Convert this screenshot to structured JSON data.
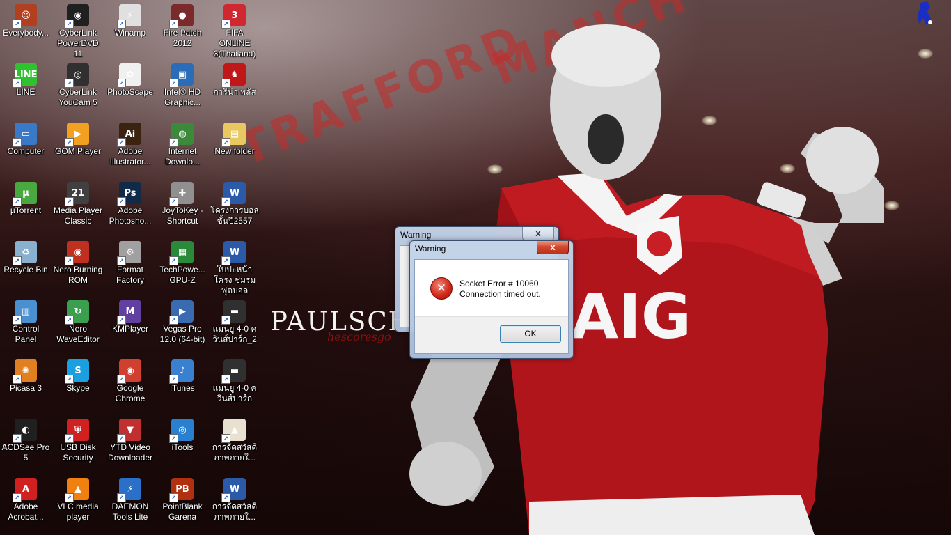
{
  "wallpaper": {
    "stand_text_1": "TRAFFORD",
    "stand_text_2": "MANCH",
    "sponsor": "AIG",
    "signature": "PAULSCH",
    "signature_sub": "hescoresgo"
  },
  "desktop_icons": [
    {
      "label": "Everybody...",
      "icon": "avatar-icon",
      "color": "#b04020",
      "text": "☺"
    },
    {
      "label": "CyberLink PowerDVD 11",
      "icon": "powerdvd-icon",
      "color": "#202020",
      "text": "◉"
    },
    {
      "label": "Winamp",
      "icon": "winamp-icon",
      "color": "#e0e0e0",
      "text": "⚡"
    },
    {
      "label": "Fire Patch 2012",
      "icon": "firepatch-icon",
      "color": "#7a2a2a",
      "text": "●"
    },
    {
      "label": "FIFA ONLINE 3(Thailand)",
      "icon": "fifa-icon",
      "color": "#d02830",
      "text": "3"
    },
    {
      "label": "LINE",
      "icon": "line-icon",
      "color": "#2fc12f",
      "text": "LINE"
    },
    {
      "label": "CyberLink YouCam 5",
      "icon": "youcam-icon",
      "color": "#303030",
      "text": "◎"
    },
    {
      "label": "PhotoScape",
      "icon": "photoscape-icon",
      "color": "#f0f0f0",
      "text": "✿"
    },
    {
      "label": "Intel® HD Graphic...",
      "icon": "intel-icon",
      "color": "#2a6cb8",
      "text": "▣"
    },
    {
      "label": "การีน่า พลัส",
      "icon": "garena-icon",
      "color": "#c01818",
      "text": "♞"
    },
    {
      "label": "Computer",
      "icon": "computer-icon",
      "color": "#3a78c8",
      "text": "▭"
    },
    {
      "label": "GOM Player",
      "icon": "gom-icon",
      "color": "#f2a020",
      "text": "▶"
    },
    {
      "label": "Adobe Illustrator...",
      "icon": "illustrator-icon",
      "color": "#3a2410",
      "text": "Ai"
    },
    {
      "label": "Internet Downlo...",
      "icon": "idm-icon",
      "color": "#3a8a3a",
      "text": "◍"
    },
    {
      "label": "New folder",
      "icon": "folder-icon",
      "color": "#e8c860",
      "text": "▤"
    },
    {
      "label": "µTorrent",
      "icon": "utorrent-icon",
      "color": "#4aa840",
      "text": "µ"
    },
    {
      "label": "Media Player Classic",
      "icon": "mpc-icon",
      "color": "#404040",
      "text": "21"
    },
    {
      "label": "Adobe Photosho...",
      "icon": "photoshop-icon",
      "color": "#102a48",
      "text": "Ps"
    },
    {
      "label": "JoyToKey - Shortcut",
      "icon": "joytokey-icon",
      "color": "#909090",
      "text": "✚"
    },
    {
      "label": "โครงการบอล ชั้นปี2557",
      "icon": "word-doc-icon",
      "color": "#2a5aa8",
      "text": "W"
    },
    {
      "label": "Recycle Bin",
      "icon": "recycle-bin-icon",
      "color": "#8ab0d0",
      "text": "♻"
    },
    {
      "label": "Nero Burning ROM",
      "icon": "nero-icon",
      "color": "#c03020",
      "text": "◉"
    },
    {
      "label": "Format Factory",
      "icon": "formatfactory-icon",
      "color": "#a0a0a0",
      "text": "⚙"
    },
    {
      "label": "TechPowe... GPU-Z",
      "icon": "gpuz-icon",
      "color": "#2a8a3a",
      "text": "▦"
    },
    {
      "label": "ใบปะหน้าโครง ชมรมฟุตบอล",
      "icon": "word-doc-icon",
      "color": "#2a5aa8",
      "text": "W"
    },
    {
      "label": "Control Panel",
      "icon": "control-panel-icon",
      "color": "#4a90d0",
      "text": "▥"
    },
    {
      "label": "Nero WaveEditor",
      "icon": "nero-wave-icon",
      "color": "#3aa050",
      "text": "↻"
    },
    {
      "label": "KMPlayer",
      "icon": "kmplayer-icon",
      "color": "#6040a0",
      "text": "M"
    },
    {
      "label": "Vegas Pro 12.0 (64-bit)",
      "icon": "vegas-icon",
      "color": "#3a6ab0",
      "text": "▶"
    },
    {
      "label": "แมนยู 4-0 ควินส์ปาร์ก_2",
      "icon": "video-file-icon",
      "color": "#303030",
      "text": "▬"
    },
    {
      "label": "Picasa 3",
      "icon": "picasa-icon",
      "color": "#e08020",
      "text": "✺"
    },
    {
      "label": "Skype",
      "icon": "skype-icon",
      "color": "#1aa0e0",
      "text": "S"
    },
    {
      "label": "Google Chrome",
      "icon": "chrome-icon",
      "color": "#d04030",
      "text": "◉"
    },
    {
      "label": "iTunes",
      "icon": "itunes-icon",
      "color": "#3a80d0",
      "text": "♪"
    },
    {
      "label": "แมนยู 4-0 ควินส์ปาร์ก",
      "icon": "video-file-icon",
      "color": "#303030",
      "text": "▬"
    },
    {
      "label": "ACDSee Pro 5",
      "icon": "acdsee-icon",
      "color": "#202020",
      "text": "◐"
    },
    {
      "label": "USB Disk Security",
      "icon": "usb-security-icon",
      "color": "#d02020",
      "text": "⛨"
    },
    {
      "label": "YTD Video Downloader",
      "icon": "ytd-icon",
      "color": "#c03030",
      "text": "▼"
    },
    {
      "label": "iTools",
      "icon": "itools-icon",
      "color": "#2a80d0",
      "text": "◎"
    },
    {
      "label": "การจัดสวัสดิ ภาพภายใ...",
      "icon": "picture-file-icon",
      "color": "#e8e0d0",
      "text": "▲"
    },
    {
      "label": "Adobe Acrobat...",
      "icon": "acrobat-icon",
      "color": "#d02020",
      "text": "A"
    },
    {
      "label": "VLC media player",
      "icon": "vlc-icon",
      "color": "#f08010",
      "text": "▲"
    },
    {
      "label": "DAEMON Tools Lite",
      "icon": "daemon-icon",
      "color": "#2a70c8",
      "text": "⚡"
    },
    {
      "label": "PointBlank Garena",
      "icon": "pointblank-icon",
      "color": "#b03010",
      "text": "PB"
    },
    {
      "label": "การจัดสวัสดิ ภาพภายใ...",
      "icon": "word-doc-icon",
      "color": "#2a5aa8",
      "text": "W"
    }
  ],
  "back_dialog": {
    "title": "Warning",
    "close_label": "x"
  },
  "front_dialog": {
    "title": "Warning",
    "close_label": "x",
    "message_line1": "Socket Error # 10060",
    "message_line2": "Connection timed out.",
    "error_glyph": "✕",
    "ok_label": "OK"
  }
}
